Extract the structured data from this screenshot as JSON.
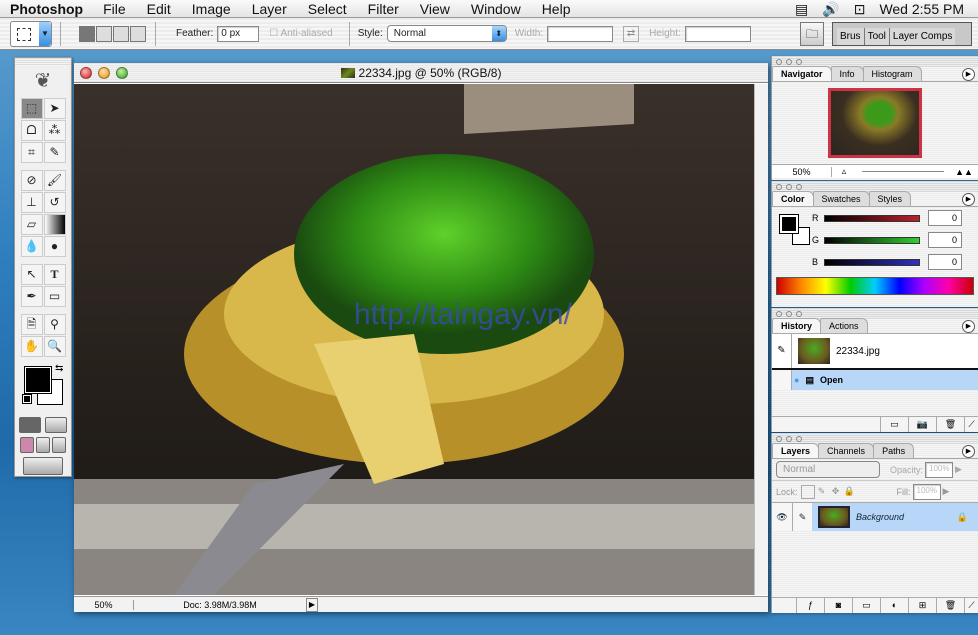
{
  "menubar": {
    "app": "Photoshop",
    "items": [
      "File",
      "Edit",
      "Image",
      "Layer",
      "Select",
      "Filter",
      "View",
      "Window",
      "Help"
    ],
    "clock": "Wed 2:55 PM"
  },
  "options": {
    "feather_label": "Feather:",
    "feather_value": "0 px",
    "antialias": "Anti-aliased",
    "style_label": "Style:",
    "style_value": "Normal",
    "width_label": "Width:",
    "height_label": "Height:",
    "well_tabs": [
      "Brus",
      "Tool",
      "Layer Comps"
    ]
  },
  "document": {
    "title": "22334.jpg @ 50% (RGB/8)",
    "zoom": "50%",
    "doc_size": "Doc: 3.98M/3.98M",
    "watermark": "http://taingay.vn/"
  },
  "navigator": {
    "tabs": [
      "Navigator",
      "Info",
      "Histogram"
    ],
    "zoom": "50%"
  },
  "color": {
    "tabs": [
      "Color",
      "Swatches",
      "Styles"
    ],
    "channels": [
      {
        "label": "R",
        "value": "0"
      },
      {
        "label": "G",
        "value": "0"
      },
      {
        "label": "B",
        "value": "0"
      }
    ]
  },
  "history": {
    "tabs": [
      "History",
      "Actions"
    ],
    "snapshot": "22334.jpg",
    "steps": [
      "Open"
    ]
  },
  "layers": {
    "tabs": [
      "Layers",
      "Channels",
      "Paths"
    ],
    "blend": "Normal",
    "opacity_label": "Opacity:",
    "opacity": "100%",
    "lock_label": "Lock:",
    "fill_label": "Fill:",
    "fill": "100%",
    "items": [
      {
        "name": "Background",
        "locked": true,
        "visible": true
      }
    ]
  }
}
